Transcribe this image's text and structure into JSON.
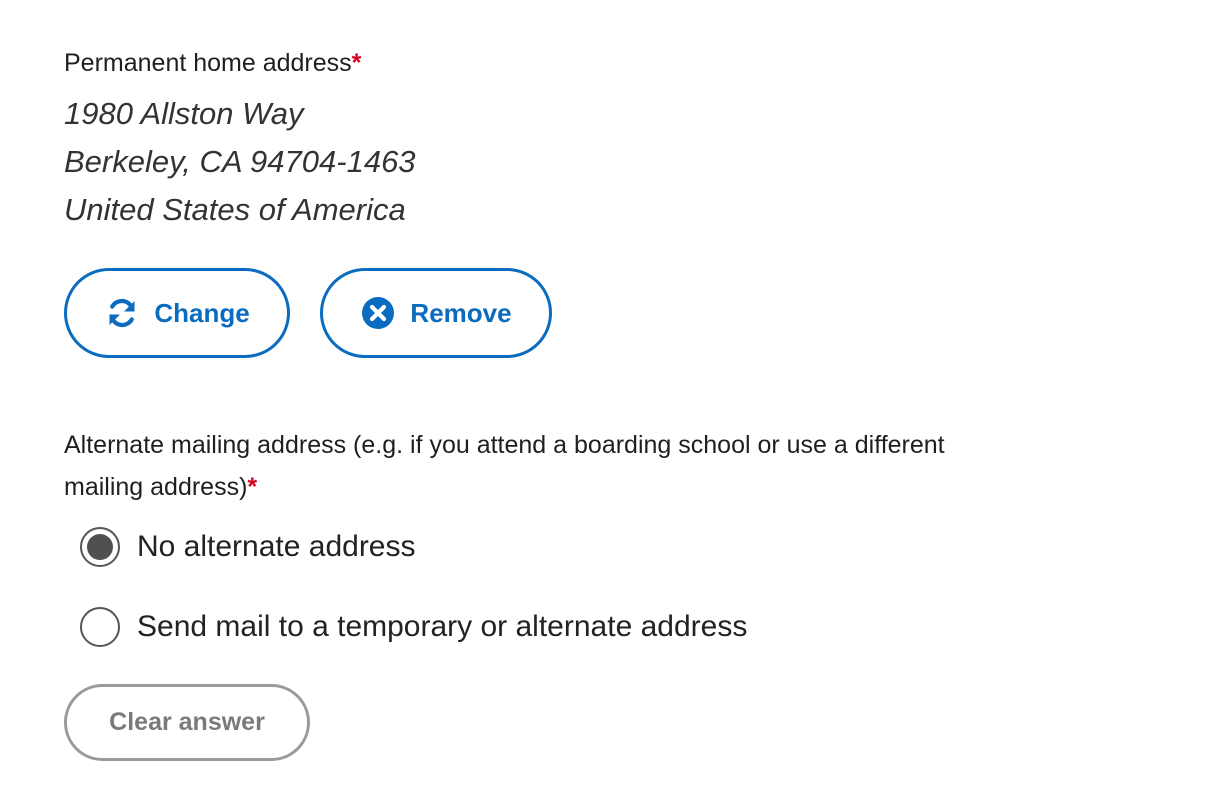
{
  "permanent_address": {
    "label": "Permanent home address",
    "required_marker": "*",
    "lines": [
      "1980 Allston Way",
      "Berkeley, CA 94704-1463",
      "United States of America"
    ],
    "buttons": {
      "change_label": "Change",
      "change_icon": "refresh-icon",
      "remove_label": "Remove",
      "remove_icon": "close-circle-icon"
    }
  },
  "alternate_address": {
    "label": "Alternate mailing address (e.g. if you attend a boarding school or use a different mailing address)",
    "required_marker": "*",
    "options": [
      {
        "label": "No alternate address",
        "selected": true
      },
      {
        "label": "Send mail to a temporary or alternate address",
        "selected": false
      }
    ],
    "clear_label": "Clear answer"
  },
  "colors": {
    "accent": "#0a6bbf",
    "required": "#d7001e",
    "disabled": "#9a9a9a"
  }
}
